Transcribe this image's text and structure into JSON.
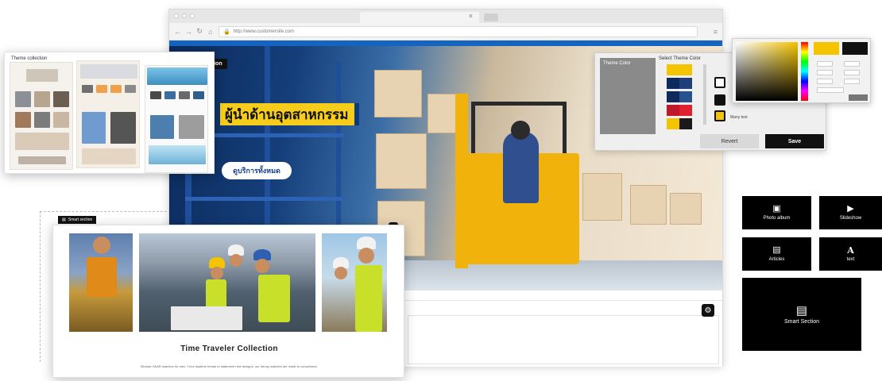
{
  "browser": {
    "url": "http://www.customersite.com",
    "controls": {
      "back": "←",
      "forward": "→",
      "reload": "↻",
      "home": "⌂",
      "menu": "≡",
      "tab_close": "×"
    }
  },
  "hero": {
    "section_tag": "ection",
    "title": "ผู้นำด้านอุตสาหกรรม",
    "cta": "ดูบริการทั้งหมด"
  },
  "theme_collection": {
    "title": "Theme collection"
  },
  "theme_color": {
    "sidebar_label": "Theme Color",
    "select_label": "Select Theme Color",
    "more_label": "Many text",
    "revert_label": "Revert",
    "save_label": "Save",
    "swatches": [
      [
        "#f4c400",
        "#f4c400"
      ],
      [
        "#0e2a5c",
        "#1f3f7a"
      ],
      [
        "#0e2a5c",
        "#27528f"
      ],
      [
        "#c0172b",
        "#e0202f"
      ],
      [
        "#f4c400",
        "#1a1a1a"
      ]
    ]
  },
  "color_picker": {
    "new_color": "#f4c400",
    "old_color": "#111111"
  },
  "smart_section": {
    "tag": "Smart section",
    "title": "Time Traveler Collection",
    "description": "Browse HAAR watches for men. From daytime trends to statement new designs, our trendy watches are made to compliment."
  },
  "tiles": [
    {
      "label": "Photo album",
      "icon": "image-icon",
      "glyph": "▣"
    },
    {
      "label": "Slideshow",
      "icon": "play-icon",
      "glyph": "▶"
    },
    {
      "label": "Articles",
      "icon": "document-icon",
      "glyph": "▤"
    },
    {
      "label": "text",
      "icon": "text-icon",
      "glyph": "A"
    }
  ],
  "smart_tile": {
    "label": "Smart Section",
    "icon": "smart-section-icon",
    "glyph": "▤"
  }
}
